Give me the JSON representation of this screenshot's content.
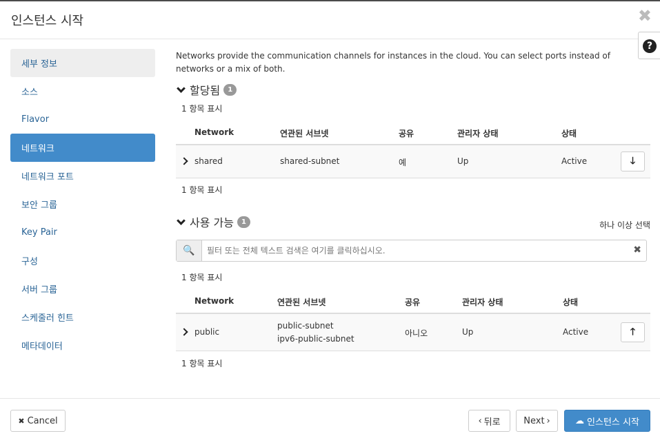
{
  "modal": {
    "title": "인스턴스 시작",
    "close_glyph": "✖",
    "help_glyph": "?"
  },
  "sidebar": {
    "items": [
      {
        "label": "세부 정보"
      },
      {
        "label": "소스"
      },
      {
        "label": "Flavor"
      },
      {
        "label": "네트워크"
      },
      {
        "label": "네트워크 포트"
      },
      {
        "label": "보안 그룹"
      },
      {
        "label": "Key Pair"
      },
      {
        "label": "구성"
      },
      {
        "label": "서버 그룹"
      },
      {
        "label": "스케줄러 힌트"
      },
      {
        "label": "메타데이터"
      }
    ],
    "active_index": 3
  },
  "main": {
    "description": "Networks provide the communication channels for instances in the cloud. You can select ports instead of networks or a mix of both.",
    "allocated": {
      "title": "할당됨",
      "badge": "1",
      "count_top": "1 항목 표시",
      "count_bottom": "1 항목 표시",
      "columns": [
        "Network",
        "연관된 서브넷",
        "공유",
        "관리자 상태",
        "상태"
      ],
      "rows": [
        {
          "network": "shared",
          "subnets": [
            "shared-subnet"
          ],
          "shared": "예",
          "admin_state": "Up",
          "status": "Active",
          "action_icon": "arrow-down-icon",
          "action_glyph": "🡓"
        }
      ]
    },
    "available": {
      "title": "사용 가능",
      "badge": "1",
      "select_hint": "하나 이상 선택",
      "search_placeholder": "필터 또는 전체 텍스트 검색은 여기를 클릭하십시오.",
      "search_icon_glyph": "🔍",
      "clear_glyph": "✖",
      "count_top": "1 항목 표시",
      "count_bottom": "1 항목 표시",
      "columns": [
        "Network",
        "연관된 서브넷",
        "공유",
        "관리자 상태",
        "상태"
      ],
      "rows": [
        {
          "network": "public",
          "subnets": [
            "public-subnet",
            "ipv6-public-subnet"
          ],
          "shared": "아니오",
          "admin_state": "Up",
          "status": "Active",
          "action_icon": "arrow-up-icon",
          "action_glyph": "🡑"
        }
      ]
    }
  },
  "footer": {
    "cancel_label": "Cancel",
    "cancel_glyph": "✖",
    "back_label": "뒤로",
    "back_glyph": "‹",
    "next_label": "Next",
    "next_glyph": "›",
    "launch_label": "인스턴스 시작",
    "launch_glyph": "☁"
  },
  "colors": {
    "primary": "#428bca",
    "link": "#2a6496",
    "badge": "#999999",
    "sidebar_selected_bg": "#eeeeee"
  }
}
